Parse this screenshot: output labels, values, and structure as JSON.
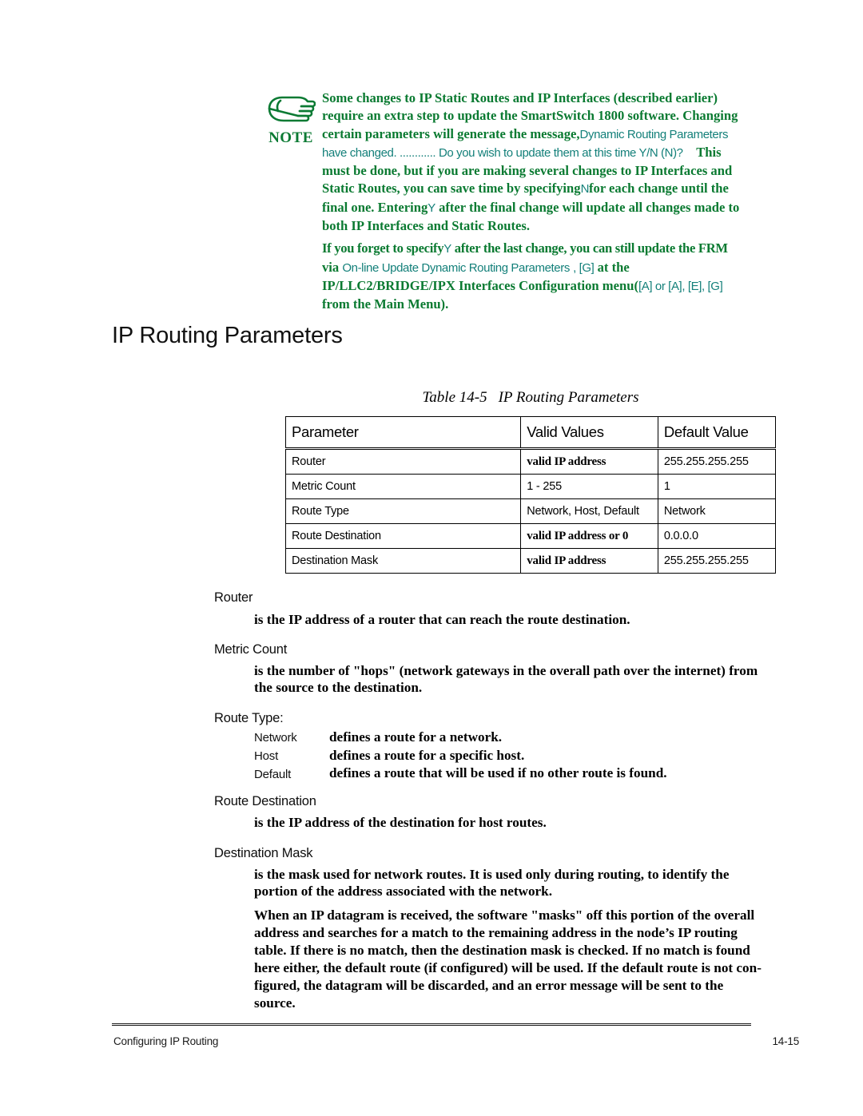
{
  "note": {
    "icon_name": "pointing-hand-icon",
    "icon_label": "NOTE",
    "accent_color": "#0a7a31",
    "secondary_color": "#14807a",
    "line1": "Some changes to IP Static Routes and IP Interfaces (described earlier)",
    "line2": "require an extra step to update the SmartSwitch 1800 software. Changing",
    "line3_bold_a": "certain parameters will generate the message,",
    "line3_mono": "Dynamic Routing Parameters",
    "line4_mono": "have changed. ............ Do you wish to update them at this time Y/N (N)?",
    "line4_bold": "This",
    "line5": "must be done, but if you are making several changes to IP Interfaces and",
    "line6_a": "Static Routes, you can save time by specifying",
    "line6_key": "N",
    "line6_b": "for each change until the",
    "line7_a": "final one. Entering",
    "line7_key": "Y",
    "line7_b": "after the final change will update all changes made to",
    "line8": "both IP Interfaces and Static Routes.",
    "p2_line1_a": "If you forget to specify",
    "p2_line1_key": "Y",
    "p2_line1_b": "after the last change, you can still update the FRM",
    "p2_line2_bold": "via",
    "p2_line2_mono": "On-line Update Dynamic Routing Parameters",
    "p2_line2_mono2": ", [G]",
    "p2_line2_tail": "at the",
    "p2_line3_bold": "IP/LLC2/BRIDGE/IPX Interfaces Configuration menu",
    "p2_line3_mono": "[A] or [A], [E], [G]",
    "p2_line3_paren": "(",
    "p2_line4": "from the Main Menu)."
  },
  "heading": "IP Routing Parameters",
  "table": {
    "caption_number": "Table 14-5",
    "caption_title": "IP Routing Parameters",
    "headers": [
      "Parameter",
      "Valid Values",
      "Default Value"
    ],
    "rows": [
      {
        "parameter": "Router",
        "valid_values": "valid IP address",
        "valid_bold": true,
        "default_value": "255.255.255.255"
      },
      {
        "parameter": "Metric Count",
        "valid_values": "1 - 255",
        "valid_bold": false,
        "default_value": "1"
      },
      {
        "parameter": "Route Type",
        "valid_values": "Network, Host, Default",
        "valid_bold": false,
        "default_value": "Network"
      },
      {
        "parameter": "Route Destination",
        "valid_values": "valid IP address or 0",
        "valid_bold": true,
        "default_value": "0.0.0.0"
      },
      {
        "parameter": "Destination Mask",
        "valid_values": "valid IP address",
        "valid_bold": true,
        "default_value": "255.255.255.255"
      }
    ]
  },
  "definitions": [
    {
      "term": "Router",
      "body": "is the IP address of a router that can reach the route destination."
    },
    {
      "term": "Metric Count",
      "body_line1": "is the number of \"hops\" (network gateways in the overall path over the internet) from",
      "body_line2": "the source to the destination."
    },
    {
      "term": "Route Type:",
      "subitems": [
        {
          "label": "Network",
          "text": "defines a route for a network."
        },
        {
          "label": "Host",
          "text": "defines a route for a specific host."
        },
        {
          "label": "Default",
          "text": "defines a route that will be used if no other route is found."
        }
      ]
    },
    {
      "term": "Route Destination",
      "body": "is the IP address of the destination for host routes."
    },
    {
      "term": "Destination Mask",
      "body_line1": "is the mask used for network routes. It is used only during routing, to identify the",
      "body_line2": "portion of the address associated with the network.",
      "para2_line1": "When an IP datagram is received, the software \"masks\" off this portion of the overall",
      "para2_line2": "address and searches for a match to the remaining address in the node’s IP routing",
      "para2_line3": "table. If there is no match, then the destination mask is checked. If no match is found",
      "para2_line4": "here either, the default route (if configured) will be used. If the default route is not con-",
      "para2_line5": "figured, the datagram will be discarded, and an error message will be sent to the",
      "para2_line6": "source."
    }
  ],
  "footer": {
    "left": "Configuring IP Routing",
    "right": "14-15"
  }
}
